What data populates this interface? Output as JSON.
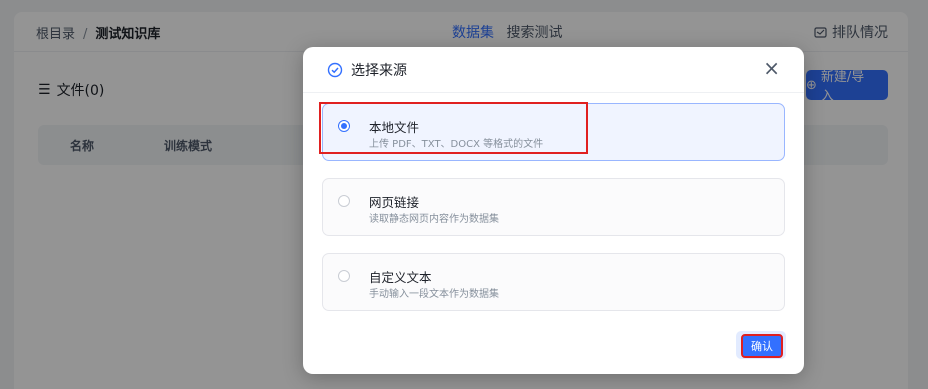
{
  "breadcrumb": {
    "root": "根目录",
    "separator": "/",
    "current": "测试知识库"
  },
  "tabs": [
    {
      "label": "数据集",
      "active": true
    },
    {
      "label": "搜索测试",
      "active": false
    }
  ],
  "queue": {
    "icon": "queue-icon",
    "label": "排队情况"
  },
  "files": {
    "header": "文件(0)"
  },
  "new_button": {
    "label": "新建/导入"
  },
  "table": {
    "columns": [
      "名称",
      "训练模式"
    ]
  },
  "modal": {
    "title": "选择来源",
    "close": "×",
    "options": [
      {
        "title": "本地文件",
        "desc": "上传 PDF、TXT、DOCX 等格式的文件",
        "selected": true
      },
      {
        "title": "网页链接",
        "desc": "读取静态网页内容作为数据集",
        "selected": false
      },
      {
        "title": "自定义文本",
        "desc": "手动输入一段文本作为数据集",
        "selected": false
      }
    ],
    "confirm": "确认"
  },
  "colors": {
    "accent": "#3370ff",
    "highlight": "#e02020"
  }
}
